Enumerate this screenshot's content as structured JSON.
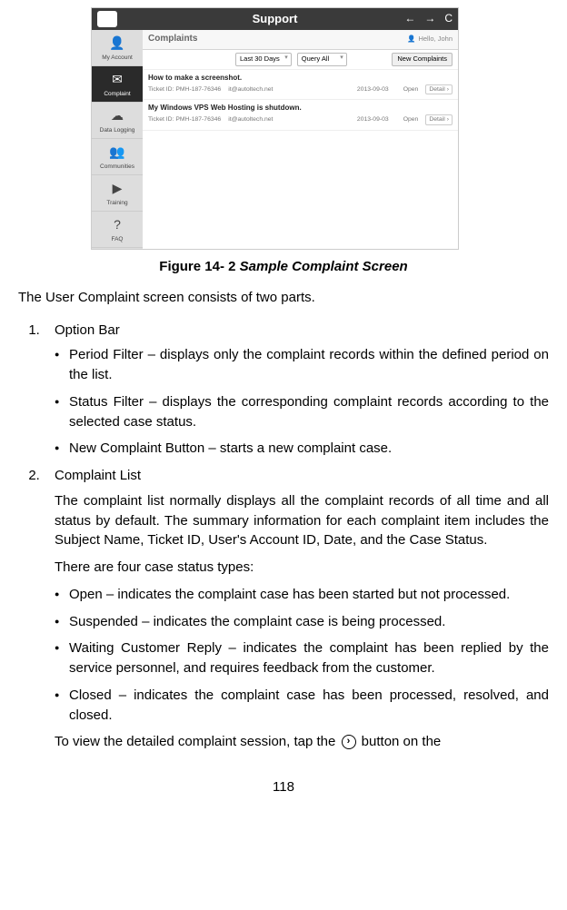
{
  "screenshot": {
    "titlebar": {
      "title": "Support"
    },
    "sidebar": {
      "items": [
        {
          "label": "My Account"
        },
        {
          "label": "Complaint"
        },
        {
          "label": "Data Logging"
        },
        {
          "label": "Communities"
        },
        {
          "label": "Training"
        },
        {
          "label": "FAQ"
        }
      ]
    },
    "header": {
      "title": "Complaints",
      "user": "Hello, John"
    },
    "filters": {
      "period": "Last 30 Days",
      "status": "Query All",
      "newBtn": "New Complaints"
    },
    "rows": [
      {
        "title": "How to make a screenshot.",
        "ticket": "Ticket ID: PMH-187-76346",
        "account": "it@autoltech.net",
        "date": "2013-09-03",
        "status": "Open",
        "detail": "Detail"
      },
      {
        "title": "My Windows VPS Web Hosting is shutdown.",
        "ticket": "Ticket ID: PMH-187-76346",
        "account": "it@autoltech.net",
        "date": "2013-09-03",
        "status": "Open",
        "detail": "Detail"
      }
    ]
  },
  "figure": {
    "prefix": "Figure 14- 2 ",
    "title": "Sample Complaint Screen"
  },
  "intro": "The User Complaint screen consists of two parts.",
  "list": [
    {
      "title": "Option Bar",
      "bullets": [
        "Period Filter – displays only the complaint records within the defined period on the list.",
        "Status Filter – displays the corresponding complaint records according to the selected case status.",
        "New Complaint Button – starts a new complaint case."
      ]
    },
    {
      "title": "Complaint List",
      "para1": "The complaint list normally displays all the complaint records of all time and all status by default. The summary information for each complaint item includes the Subject Name, Ticket ID, User's Account ID, Date, and the Case Status.",
      "para2": "There are four case status types:",
      "bullets": [
        "Open – indicates the complaint case has been started but not processed.",
        "Suspended – indicates the complaint case is being processed.",
        "Waiting Customer Reply – indicates the complaint has been replied by the service personnel, and requires feedback from the customer.",
        "Closed – indicates the complaint case has been processed, resolved, and closed."
      ],
      "trail_before": "To view the detailed complaint session, tap the ",
      "trail_after": " button on the"
    }
  ],
  "pageNum": "118"
}
